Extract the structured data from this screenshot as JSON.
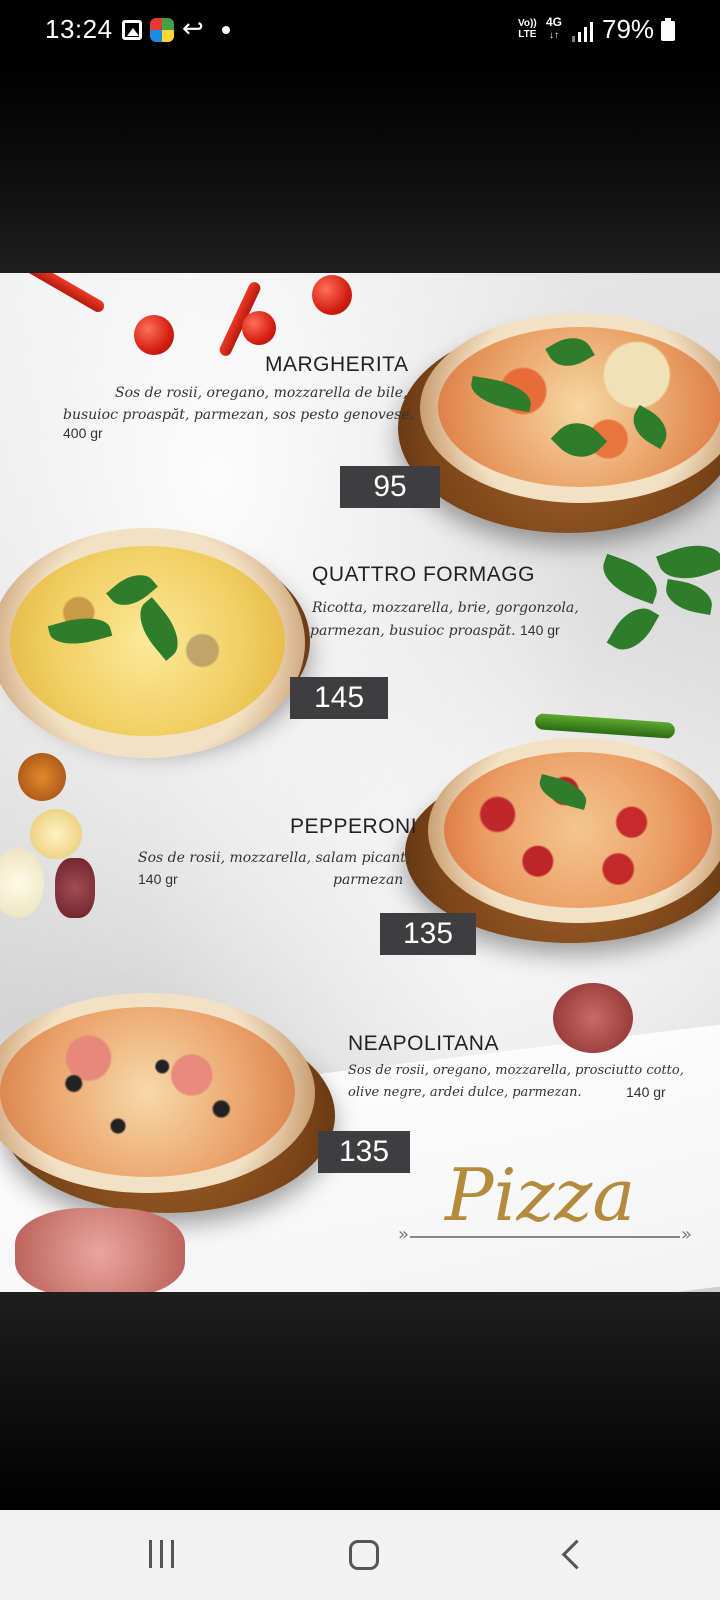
{
  "status_bar": {
    "time": "13:24",
    "network_top": "Vo))",
    "network_bottom": "LTE",
    "generation_top": "4G",
    "generation_bottom": "↓↑",
    "battery": "79%",
    "icons": [
      "gallery-icon",
      "app-icon",
      "call-icon",
      "notification-dot",
      "lte-icon",
      "4g-icon",
      "signal-icon",
      "battery-icon"
    ]
  },
  "menu": {
    "heading": "Pizza",
    "items": [
      {
        "name": "MARGHERITA",
        "description_line1": "Sos de rosii, oregano, mozzarella de bile,",
        "description_line2": "busuioc proaspăt, parmezan, sos pesto genovese.",
        "weight": "400 gr",
        "price": "95"
      },
      {
        "name": "QUATTRO FORMAGG",
        "description_line1": "Ricotta, mozzarella, brie, gorgonzola,",
        "description_line2": "parmezan, busuioc proaspăt.",
        "weight": "140 gr",
        "price": "145"
      },
      {
        "name": "PEPPERONI",
        "description_line1": "Sos de rosii, mozzarella, salam picant,",
        "description_line2": "parmezan",
        "weight": "140 gr",
        "price": "135"
      },
      {
        "name": "NEAPOLITANA",
        "description_line1": "Sos de rosii, oregano, mozzarella, prosciutto cotto,",
        "description_line2": "olive negre, ardei dulce, parmezan.",
        "weight": "140 gr",
        "price": "135"
      }
    ]
  },
  "colors": {
    "price_box": "#3e3e40",
    "heading_gold": "#b48a3d",
    "nav_bar": "#f2f2f2"
  },
  "nav_bar": {
    "buttons": [
      "recents-button",
      "home-button",
      "back-button"
    ]
  }
}
